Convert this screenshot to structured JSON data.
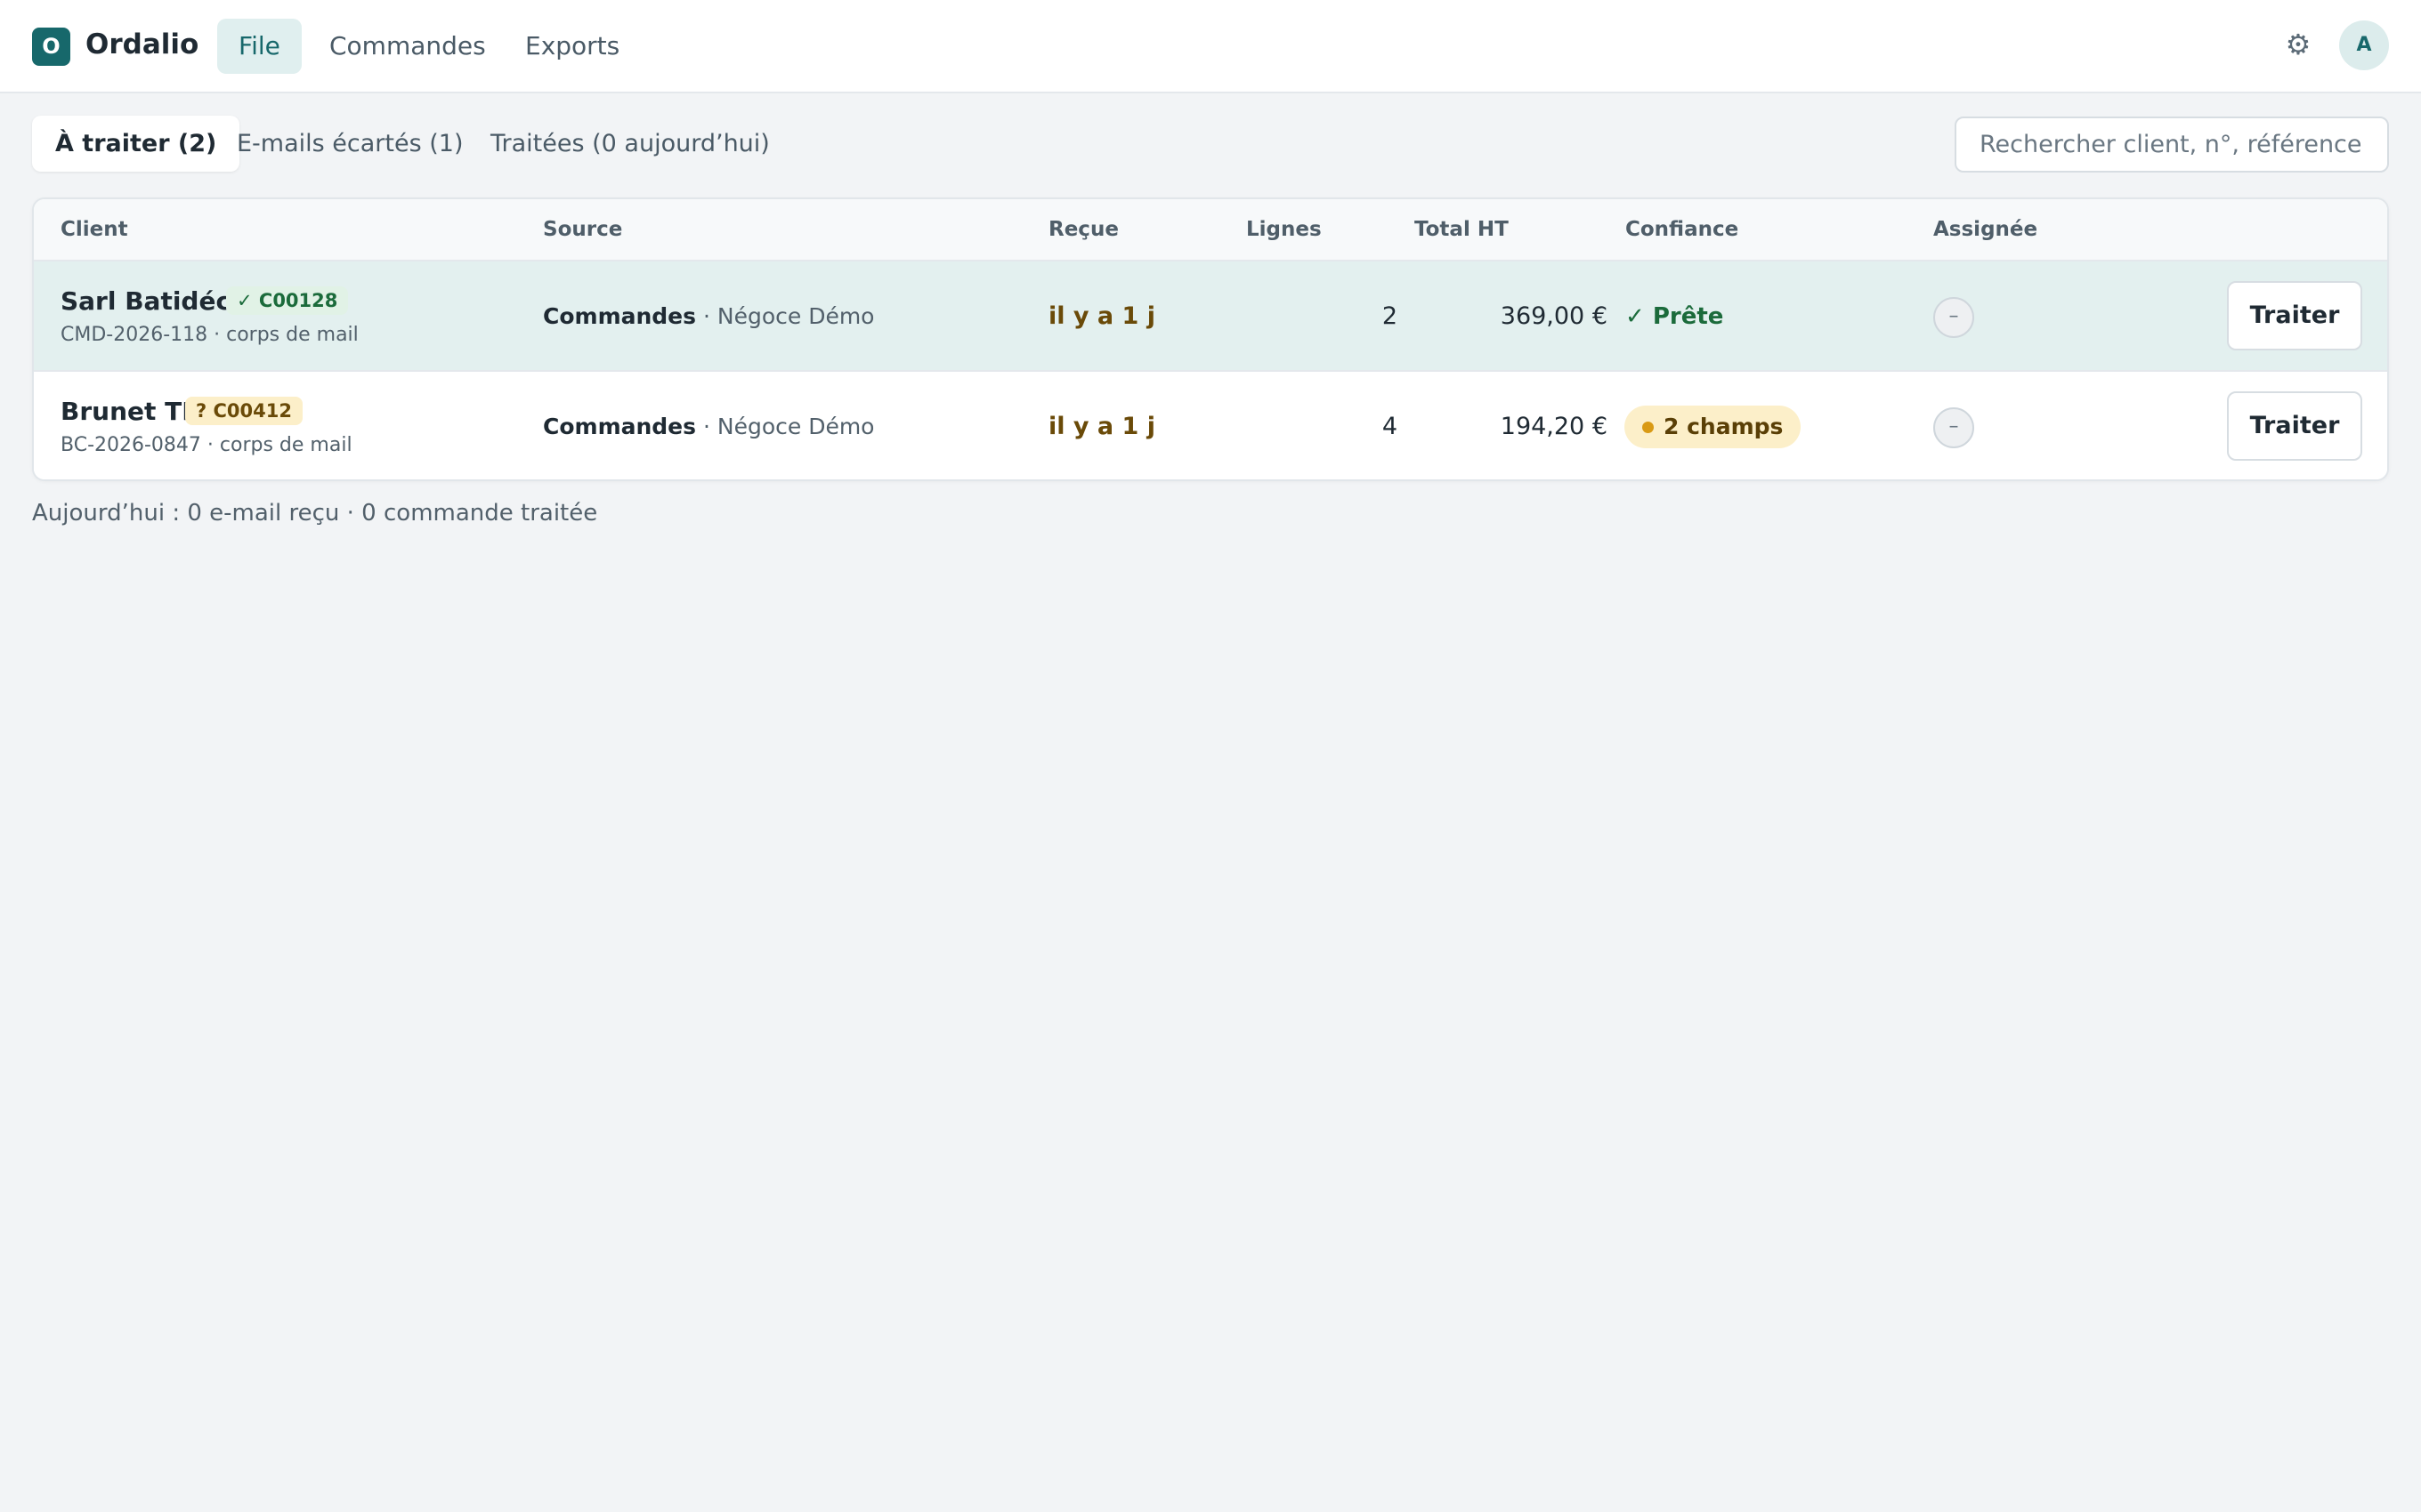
{
  "app": {
    "logo_letter": "O",
    "name": "Ordalio"
  },
  "nav": {
    "items": [
      {
        "label": "File",
        "active": true
      },
      {
        "label": "Commandes"
      },
      {
        "label": "Exports"
      }
    ]
  },
  "header": {
    "settings_icon": "gear-icon",
    "avatar_letter": "A"
  },
  "tabs": [
    {
      "label": "À traiter (2)",
      "active": true
    },
    {
      "label": "E-mails écartés (1)"
    },
    {
      "label": "Traitées (0 aujourd’hui)"
    }
  ],
  "search": {
    "placeholder": "Rechercher client, n°, référence…",
    "value": ""
  },
  "table": {
    "headers": {
      "client": "Client",
      "source": "Source",
      "received": "Reçue",
      "lines": "Lignes",
      "total": "Total HT",
      "confidence": "Confiance",
      "assignee": "Assignée"
    },
    "rows": [
      {
        "client": "Sarl Batidéco",
        "code": "✓ C00128",
        "code_status": "matched",
        "ref": "CMD-2026-118 · corps de mail",
        "source_main": "Commandes",
        "source_sep": " · ",
        "source_sub": "Négoce Démo",
        "received": "il y a 1 j",
        "lines": "2",
        "total": "369,00 €",
        "confidence": "✓ Prête",
        "confidence_status": "ready",
        "assignee": "–",
        "action": "Traiter",
        "highlighted": true
      },
      {
        "client": "Brunet TP",
        "code": "? C00412",
        "code_status": "uncertain",
        "ref": "BC-2026-0847 · corps de mail",
        "source_main": "Commandes",
        "source_sep": " · ",
        "source_sub": "Négoce Démo",
        "received": "il y a 1 j",
        "lines": "4",
        "total": "194,20 €",
        "confidence": "2 champs",
        "confidence_status": "fields-missing",
        "assignee": "–",
        "action": "Traiter",
        "highlighted": false
      }
    ]
  },
  "footer": {
    "summary": "Aujourd’hui : 0 e-mail reçu · 0 commande traitée"
  },
  "colors": {
    "brand": "#17686b",
    "ready": "#1b6b3b",
    "warning": "#d99a14",
    "received": "#6a4a08"
  }
}
